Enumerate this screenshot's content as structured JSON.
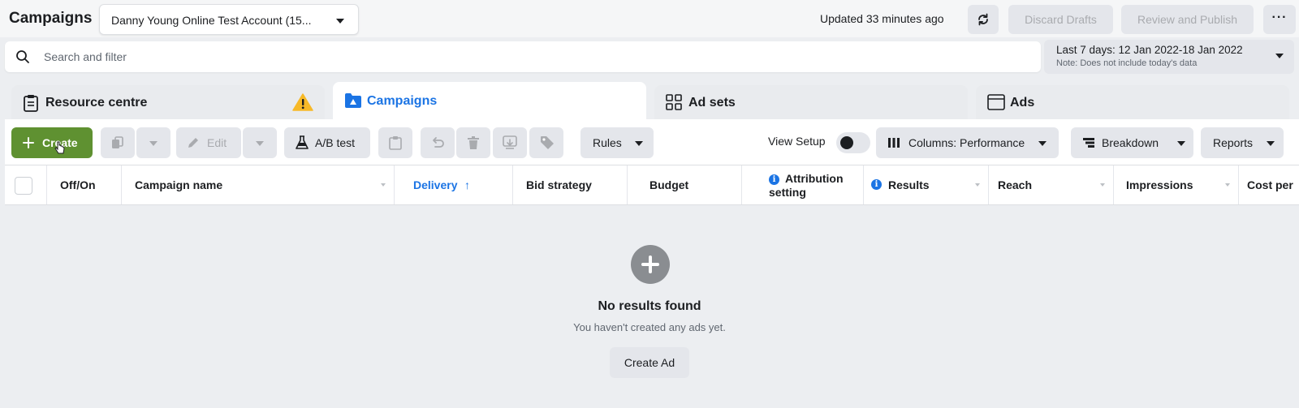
{
  "header": {
    "title": "Campaigns",
    "account_name": "Danny Young Online Test Account (15...",
    "updated_text": "Updated 33 minutes ago",
    "discard_label": "Discard Drafts",
    "publish_label": "Review and Publish",
    "more_label": "···"
  },
  "search": {
    "placeholder": "Search and filter"
  },
  "date_range": {
    "label": "Last 7 days: 12 Jan 2022-18 Jan 2022",
    "note": "Note: Does not include today's data"
  },
  "tabs": [
    {
      "label": "Resource centre",
      "icon": "clipboard-icon",
      "active": false
    },
    {
      "label": "Campaigns",
      "icon": "folder-icon",
      "active": true
    },
    {
      "label": "Ad sets",
      "icon": "grid-icon",
      "active": false
    },
    {
      "label": "Ads",
      "icon": "window-icon",
      "active": false
    }
  ],
  "toolbar": {
    "create_label": "Create",
    "edit_label": "Edit",
    "ab_test_label": "A/B test",
    "rules_label": "Rules",
    "view_setup_label": "View Setup",
    "columns_label": "Columns: Performance",
    "breakdown_label": "Breakdown",
    "reports_label": "Reports"
  },
  "table": {
    "columns": [
      "Off/On",
      "Campaign name",
      "Delivery",
      "Bid strategy",
      "Budget",
      "Attribution setting",
      "Results",
      "Reach",
      "Impressions",
      "Cost per"
    ],
    "sorted_column": "Delivery",
    "sort_direction": "↑"
  },
  "empty_state": {
    "title": "No results found",
    "subtitle": "You haven't created any ads yet.",
    "button_label": "Create Ad"
  },
  "colors": {
    "accent": "#1b74e4",
    "create_green": "#5f9131",
    "warning": "#f7b928"
  }
}
